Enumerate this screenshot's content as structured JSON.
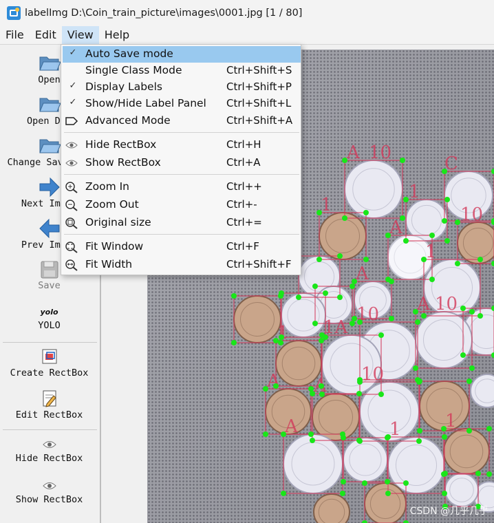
{
  "window": {
    "title": "labelImg D:\\Coin_train_picture\\images\\0001.jpg [1 / 80]"
  },
  "menubar": {
    "items": [
      "File",
      "Edit",
      "View",
      "Help"
    ],
    "active": "View"
  },
  "toolbar": {
    "open": "Open",
    "open_dir": "Open Dir",
    "change_save_dir": "Change Save Dir",
    "next_image": "Next Image",
    "prev_image": "Prev Image",
    "save": "Save",
    "format_icon_text": "yolo",
    "format": "YOLO",
    "create_rectbox": "Create RectBox",
    "edit_rectbox": "Edit RectBox",
    "hide_rectbox": "Hide RectBox",
    "show_rectbox": "Show RectBox"
  },
  "view_menu": {
    "items": [
      {
        "label": "Auto Save mode",
        "shortcut": "",
        "checked": true,
        "highlighted": true,
        "icon": "check-icon"
      },
      {
        "label": "Single Class Mode",
        "shortcut": "Ctrl+Shift+S",
        "checked": false,
        "icon": ""
      },
      {
        "label": "Display Labels",
        "shortcut": "Ctrl+Shift+P",
        "checked": true,
        "icon": "check-icon"
      },
      {
        "label": "Show/Hide Label Panel",
        "shortcut": "Ctrl+Shift+L",
        "checked": true,
        "icon": "check-icon"
      },
      {
        "label": "Advanced Mode",
        "shortcut": "Ctrl+Shift+A",
        "checked": false,
        "icon": "label-tag-icon"
      },
      {
        "label": "Hide RectBox",
        "shortcut": "Ctrl+H",
        "icon": "eye-icon"
      },
      {
        "label": "Show RectBox",
        "shortcut": "Ctrl+A",
        "icon": "eye-icon"
      },
      {
        "label": "Zoom In",
        "shortcut": "Ctrl++",
        "icon": "zoom-in-icon"
      },
      {
        "label": "Zoom Out",
        "shortcut": "Ctrl+-",
        "icon": "zoom-out-icon"
      },
      {
        "label": "Original size",
        "shortcut": "Ctrl+=",
        "icon": "zoom-original-icon"
      },
      {
        "label": "Fit Window",
        "shortcut": "Ctrl+F",
        "icon": "fit-window-icon"
      },
      {
        "label": "Fit Width",
        "shortcut": "Ctrl+Shift+F",
        "icon": "fit-width-icon"
      }
    ]
  },
  "canvas": {
    "box_labels": [
      "A",
      "10",
      "C",
      "1",
      "10",
      "1",
      "A",
      "1",
      "A",
      "10",
      "A",
      "10",
      "1A",
      "1",
      "A",
      "10",
      "A",
      "A",
      "1",
      "1"
    ]
  },
  "colors": {
    "highlight": "#99c9ef",
    "menubar_active": "#cfe4f7",
    "box_stroke": "#d23a5a",
    "vertex": "#19e619"
  },
  "watermark": "CSDN @几乎几乎"
}
